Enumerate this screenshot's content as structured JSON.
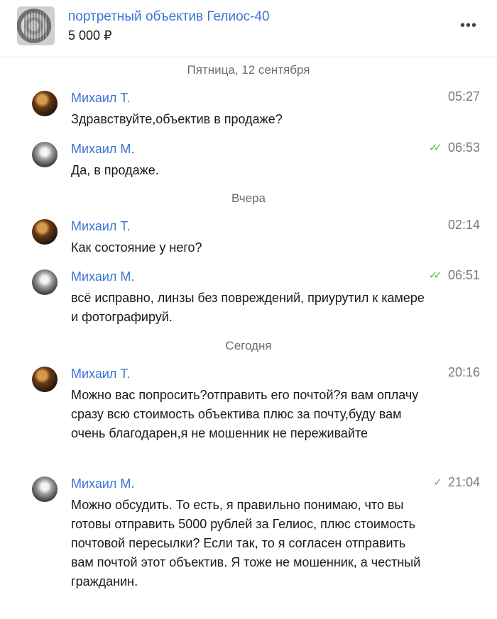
{
  "header": {
    "listing_title": "портретный объектив Гелиос-40",
    "price": "5 000 ₽",
    "menu_icon": "more-horizontal-icon"
  },
  "dates": {
    "d1": "Пятница, 12 сентября",
    "d2": "Вчера",
    "d3": "Сегодня"
  },
  "messages": [
    {
      "sender": "Михаил Т.",
      "time": "05:27",
      "text": "Здравствуйте,объектив в продаже?",
      "status": ""
    },
    {
      "sender": "Михаил М.",
      "time": "06:53",
      "text": "Да, в продаже.",
      "status": "read-double-check-icon"
    },
    {
      "sender": "Михаил Т.",
      "time": "02:14",
      "text": "Как состояние у него?",
      "status": ""
    },
    {
      "sender": "Михаил М.",
      "time": "06:51",
      "text": "всё исправно, линзы без повреждений, приурутил к камере и фотографируй.",
      "status": "read-double-check-icon"
    },
    {
      "sender": "Михаил Т.",
      "time": "20:16",
      "text": "Можно вас попросить?отправить его почтой?я вам оплачу сразу всю стоимость объектива плюс за почту,буду вам очень благодарен,я не мошенник не переживайте",
      "status": ""
    },
    {
      "sender": "Михаил М.",
      "time": "21:04",
      "text": "Можно обсудить. То есть, я правильно понимаю, что вы готовы отправить 5000 рублей за Гелиос, плюс стоимость почтовой пересылки? Если так, то я согласен отправить вам почтой этот объектив. Я тоже не мошенник, а честный гражданин.",
      "status": "sent-check-icon"
    }
  ],
  "colors": {
    "link_blue": "#3b74d6",
    "check_green": "#5ab552"
  }
}
